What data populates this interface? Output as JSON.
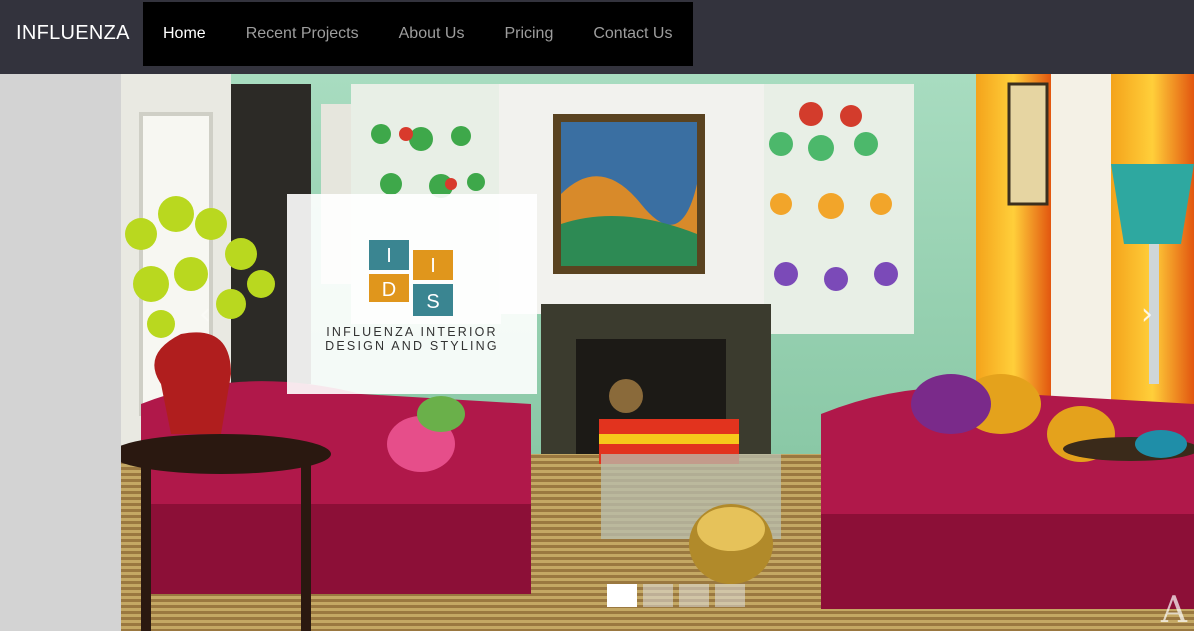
{
  "brand": "INFLUENZA",
  "nav": {
    "items": [
      {
        "label": "Home",
        "active": true
      },
      {
        "label": "Recent Projects",
        "active": false
      },
      {
        "label": "About Us",
        "active": false
      },
      {
        "label": "Pricing",
        "active": false
      },
      {
        "label": "Contact Us",
        "active": false
      }
    ]
  },
  "carousel": {
    "logo": {
      "letters": [
        "I",
        "I",
        "D",
        "S"
      ],
      "caption_line1": "INFLUENZA INTERIOR",
      "caption_line2": "DESIGN AND STYLING",
      "colors": {
        "teal": "#3a8591",
        "orange": "#e0961c"
      }
    },
    "prev_icon": "chevron-left-icon",
    "next_icon": "chevron-right-icon",
    "prev_glyph": "‹",
    "next_glyph": "›",
    "slide_count": 4,
    "active_slide": 1,
    "watermark": "A"
  },
  "colors": {
    "navbar_bg": "#33333d",
    "nav_menu_bg": "#000000",
    "nav_text": "#9d9d9d",
    "nav_active_text": "#ffffff",
    "page_bg": "#d3d3d3"
  }
}
